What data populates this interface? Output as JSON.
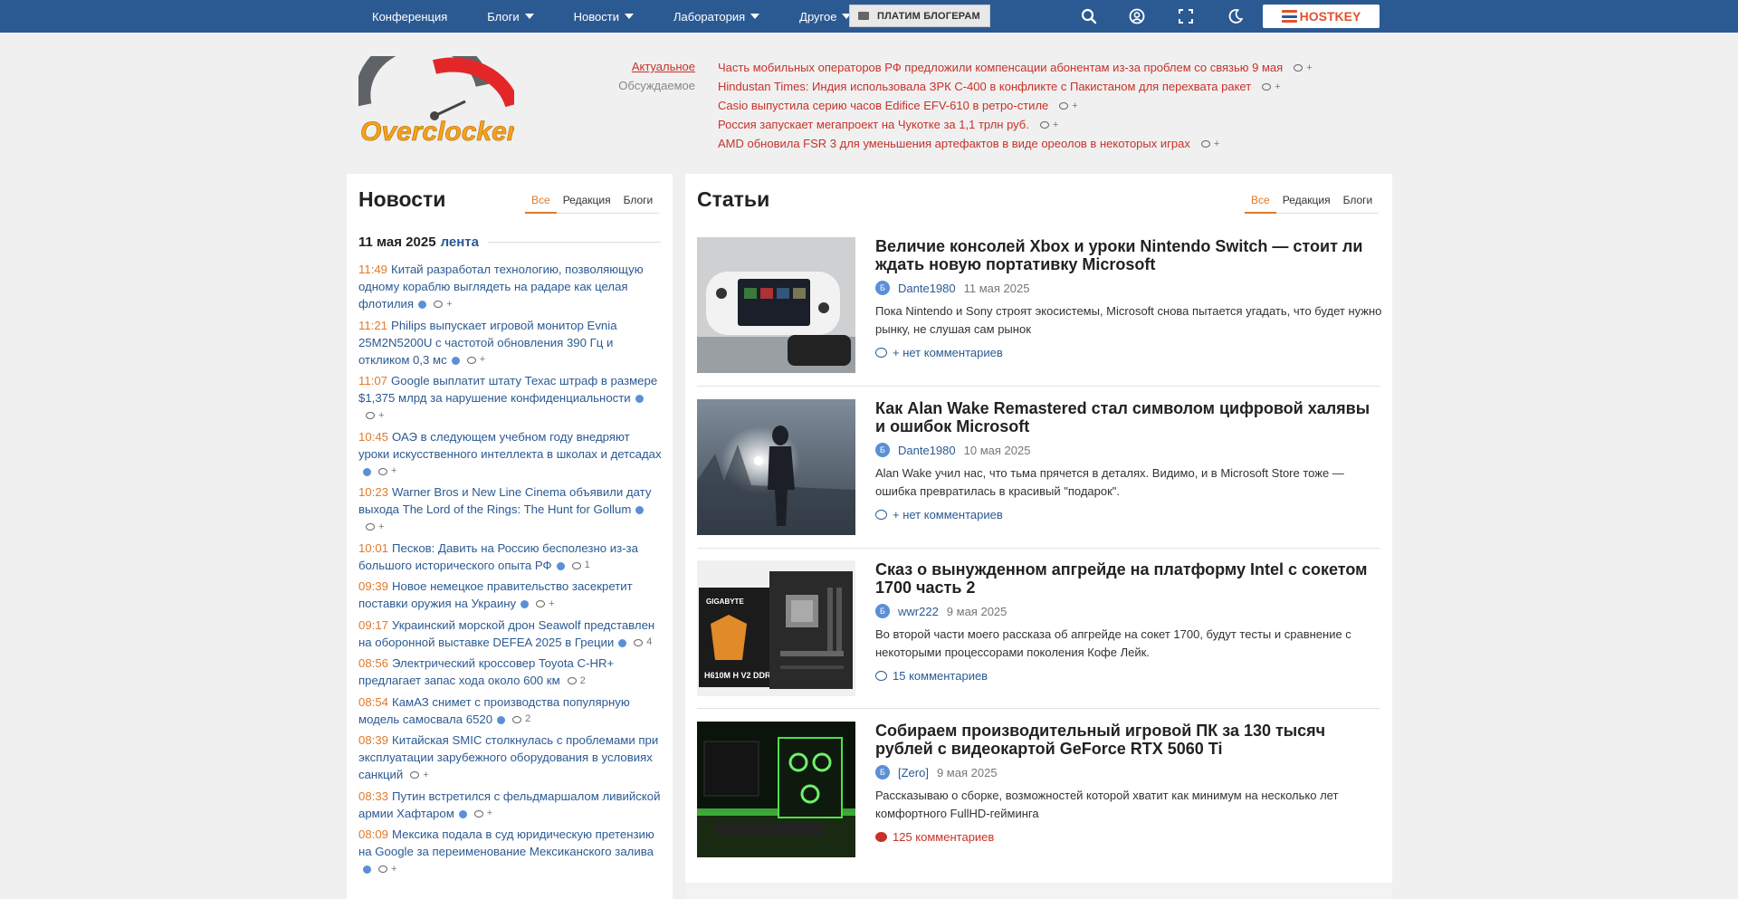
{
  "topnav": {
    "items": [
      {
        "label": "Конференция",
        "dropdown": false
      },
      {
        "label": "Блоги",
        "dropdown": true
      },
      {
        "label": "Новости",
        "dropdown": true
      },
      {
        "label": "Лаборатория",
        "dropdown": true
      },
      {
        "label": "Другое",
        "dropdown": true
      }
    ],
    "pay_button": "ПЛАТИМ БЛОГЕРАМ",
    "icons": [
      "search-icon",
      "user-icon",
      "fullscreen-icon",
      "dark-mode-icon"
    ],
    "sponsor": "HOSTKEY",
    "colors": {
      "bar": "#2b5a93",
      "sponsor": "#e2522b"
    }
  },
  "header": {
    "logo_text": "Overclockers",
    "tabs": {
      "active": "Актуальное",
      "inactive": "Обсуждаемое"
    },
    "headlines": [
      {
        "text": "Часть мобильных операторов РФ предложили компенсации абонентам из-за проблем со связью 9 мая",
        "comments": "+"
      },
      {
        "text": "Hindustan Times: Индия использовала ЗРК С-400 в конфликте с Пакистаном для перехвата ракет",
        "comments": "+"
      },
      {
        "text": "Casio выпустила серию часов Edifice EFV-610 в ретро-стиле",
        "comments": "+"
      },
      {
        "text": "Россия запускает мегапроект на Чукотке за 1,1 трлн руб.",
        "comments": "+"
      },
      {
        "text": "AMD обновила FSR 3 для уменьшения артефактов в виде ореолов в некоторых играх",
        "comments": "+"
      }
    ]
  },
  "news": {
    "title": "Новости",
    "tabs": [
      "Все",
      "Редакция",
      "Блоги"
    ],
    "date": "11 мая 2025",
    "feed_label": "лента",
    "items": [
      {
        "time": "11:49",
        "text": "Китай разработал технологию, позволяющую одному кораблю выглядеть на радаре как целая флотилия",
        "dot": true,
        "comments": "+"
      },
      {
        "time": "11:21",
        "text": "Philips выпускает игровой монитор Evnia 25M2N5200U с частотой обновления 390 Гц и откликом 0,3 мс",
        "dot": true,
        "comments": "+"
      },
      {
        "time": "11:07",
        "text": "Google выплатит штату Техас штраф в размере $1,375 млрд за нарушение конфиденциальности",
        "dot": true,
        "comments": "+"
      },
      {
        "time": "10:45",
        "text": "ОАЭ в следующем учебном году внедряют уроки искусственного интеллекта в школах и детсадах",
        "dot": true,
        "comments": "+"
      },
      {
        "time": "10:23",
        "text": "Warner Bros и New Line Cinema объявили дату выхода The Lord of the Rings: The Hunt for Gollum",
        "dot": true,
        "comments": "+"
      },
      {
        "time": "10:01",
        "text": "Песков: Давить на Россию бесполезно из-за большого исторического опыта РФ",
        "dot": true,
        "comments": "1"
      },
      {
        "time": "09:39",
        "text": "Новое немецкое правительство засекретит поставки оружия на Украину",
        "dot": true,
        "comments": "+"
      },
      {
        "time": "09:17",
        "text": "Украинский морской дрон Seawolf представлен на оборонной выставке DEFEA 2025 в Греции",
        "dot": true,
        "comments": "4"
      },
      {
        "time": "08:56",
        "text": "Электрический кроссовер Toyota C-HR+ предлагает запас хода около 600 км",
        "dot": false,
        "comments": "2"
      },
      {
        "time": "08:54",
        "text": "КамАЗ снимет с производства популярную модель самосвала 6520",
        "dot": true,
        "comments": "2"
      },
      {
        "time": "08:39",
        "text": "Китайская SMIC столкнулась с проблемами при эксплуатации зарубежного оборудования в условиях санкций",
        "dot": false,
        "comments": "+"
      },
      {
        "time": "08:33",
        "text": "Путин встретился с фельдмаршалом ливийской армии Хафтаром",
        "dot": true,
        "comments": "+"
      },
      {
        "time": "08:09",
        "text": "Мексика подала в суд юридическую претензию на Google за переименование Мексиканского залива",
        "dot": true,
        "comments": "+"
      }
    ]
  },
  "articles": {
    "title": "Статьи",
    "tabs": [
      "Все",
      "Редакция",
      "Блоги"
    ],
    "items": [
      {
        "title": "Величие консолей Xbox и уроки Nintendo Switch — стоит ли ждать новую портативку Microsoft",
        "badge": "Б",
        "author": "Dante1980",
        "date": "11 мая 2025",
        "desc": "Пока Nintendo и Sony строят экосистемы, Microsoft снова пытается угадать, что будет нужно рынку, не слушая сам рынок",
        "comments": "+ нет комментариев",
        "hot": false
      },
      {
        "title": "Как Alan Wake Remastered стал символом цифровой халявы и ошибок Microsoft",
        "badge": "Б",
        "author": "Dante1980",
        "date": "10 мая 2025",
        "desc": "Alan Wake учил нас, что тьма прячется в деталях. Видимо, и в Microsoft Store тоже — ошибка превратилась в красивый \"подарок\".",
        "comments": "+ нет комментариев",
        "hot": false
      },
      {
        "title": "Сказ о вынужденном апгрейде на платформу Intel с сокетом 1700 часть 2",
        "badge": "Б",
        "author": "wwr222",
        "date": "9 мая 2025",
        "desc": "Во второй части моего рассказа об апгрейде на сокет 1700, будут тесты и сравнение с некоторыми процессорами поколения Кофе Лейк.",
        "comments": "15 комментариев",
        "hot": false
      },
      {
        "title": "Собираем производительный игровой ПК за 130 тысяч рублей с видеокартой GeForce RTX 5060 Ti",
        "badge": "Б",
        "author": "[Zero]",
        "date": "9 мая 2025",
        "desc": "Рассказываю о сборке, возможностей которой хватит как минимум на несколько лет комфортного FullHD-гейминга",
        "comments": "125 комментариев",
        "hot": true
      }
    ]
  }
}
